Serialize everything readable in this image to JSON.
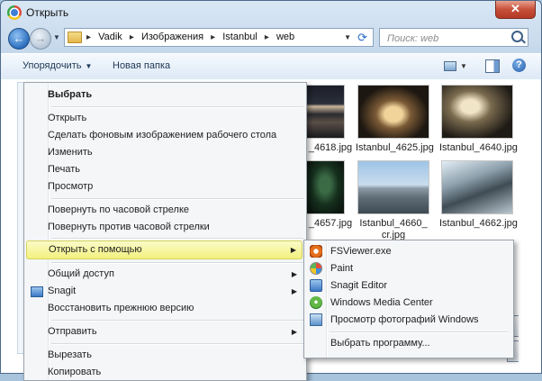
{
  "window": {
    "title": "Открыть",
    "close_label": "✕"
  },
  "address": {
    "crumbs": [
      "Vadik",
      "Изображения",
      "Istanbul",
      "web"
    ],
    "separator": "▸"
  },
  "search": {
    "placeholder": "Поиск: web"
  },
  "toolbar": {
    "organize_label": "Упорядочить",
    "new_folder_label": "Новая папка"
  },
  "thumbnails": [
    {
      "caption": "_4618.jpg"
    },
    {
      "caption": "Istanbul_4625.jpg"
    },
    {
      "caption": "Istanbul_4640.jpg"
    },
    {
      "caption": "_4657.jpg"
    },
    {
      "caption": "Istanbul_4660_cr.jpg"
    },
    {
      "caption": "Istanbul_4662.jpg"
    }
  ],
  "context_menu": {
    "items": [
      {
        "label": "Выбрать"
      },
      {
        "label": "Открыть"
      },
      {
        "label": "Сделать фоновым изображением рабочего стола"
      },
      {
        "label": "Изменить"
      },
      {
        "label": "Печать"
      },
      {
        "label": "Просмотр"
      },
      {
        "label": "Повернуть по часовой стрелке"
      },
      {
        "label": "Повернуть против часовой стрелки"
      },
      {
        "label": "Открыть с помощью"
      },
      {
        "label": "Общий доступ"
      },
      {
        "label": "Snagit"
      },
      {
        "label": "Восстановить прежнюю версию"
      },
      {
        "label": "Отправить"
      },
      {
        "label": "Вырезать"
      },
      {
        "label": "Копировать"
      }
    ]
  },
  "open_with_menu": {
    "items": [
      {
        "label": "FSViewer.exe",
        "icon": "fsviewer-icon"
      },
      {
        "label": "Paint",
        "icon": "paint-icon"
      },
      {
        "label": "Snagit Editor",
        "icon": "snagit-editor-icon"
      },
      {
        "label": "Windows Media Center",
        "icon": "media-center-icon"
      },
      {
        "label": "Просмотр фотографий Windows",
        "icon": "photo-viewer-icon"
      },
      {
        "label": "Выбрать программу..."
      }
    ]
  },
  "colors": {
    "highlight": "#f2f17e",
    "window_frame": "#c4d7ea"
  }
}
